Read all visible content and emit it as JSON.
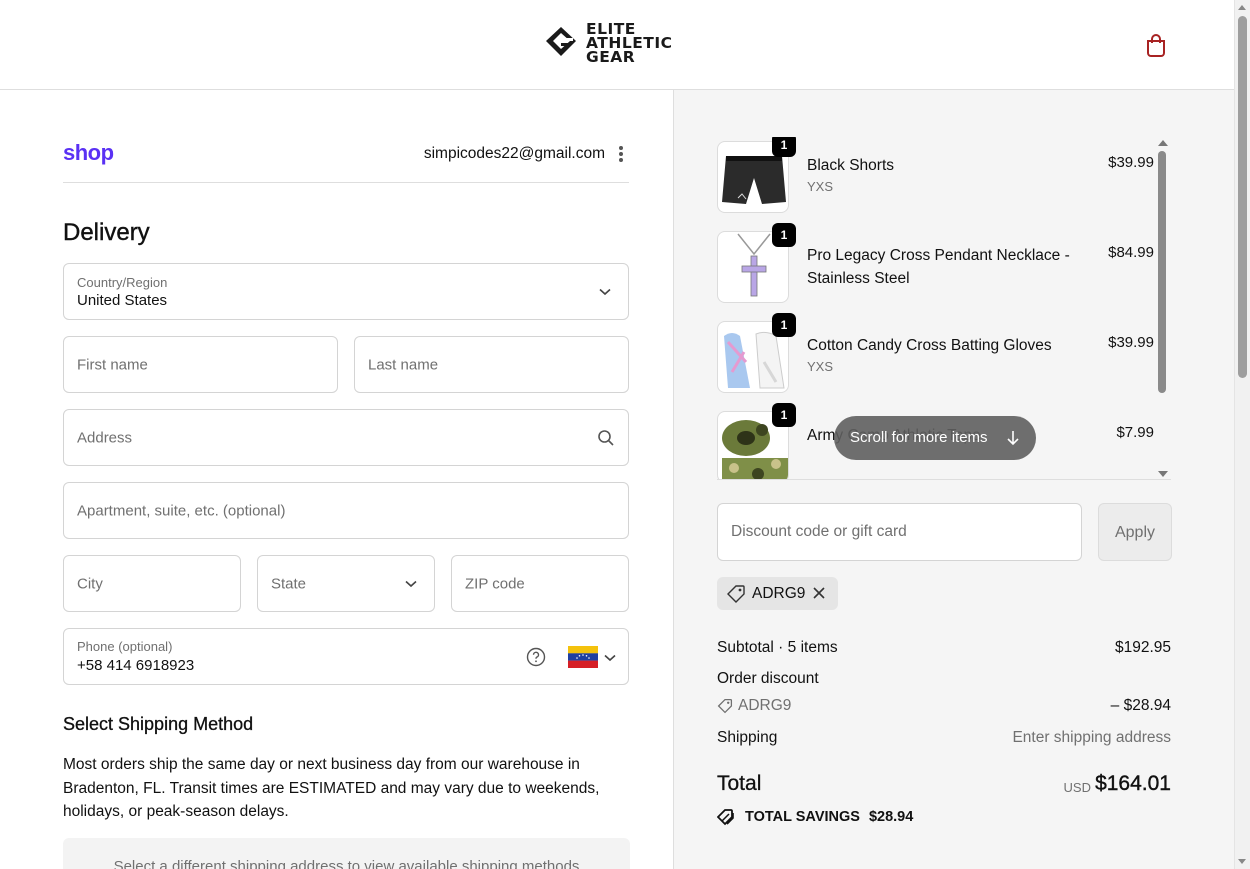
{
  "brand": {
    "logo_lines": [
      "ELITE",
      "ATHLETIC",
      "GEAR"
    ]
  },
  "header": {
    "cart_icon": "shopping-bag-icon"
  },
  "account": {
    "shop_logo": "shop",
    "email": "simpicodes22@gmail.com",
    "menu_icon": "kebab-icon"
  },
  "delivery": {
    "title": "Delivery",
    "country_label": "Country/Region",
    "country_value": "United States",
    "first_name_placeholder": "First name",
    "last_name_placeholder": "Last name",
    "address_placeholder": "Address",
    "apartment_placeholder": "Apartment, suite, etc. (optional)",
    "city_placeholder": "City",
    "state_placeholder": "State",
    "zip_placeholder": "ZIP code",
    "phone_label": "Phone (optional)",
    "phone_value": "+58 414 6918923",
    "phone_flag": "venezuela-flag"
  },
  "shipping": {
    "title": "Select Shipping Method",
    "note": "Most orders ship the same day or next business day from our warehouse in Bradenton, FL. Transit times are ESTIMATED and may vary due to weekends, holidays, or peak-season delays.",
    "placeholder_box": "Select a different shipping address to view available shipping methods"
  },
  "cart": {
    "items": [
      {
        "name": "Black Shorts",
        "variant": "YXS",
        "price": "$39.99",
        "qty": "1"
      },
      {
        "name": "Pro Legacy Cross Pendant Necklace - Stainless Steel",
        "variant": "",
        "price": "$84.99",
        "qty": "1"
      },
      {
        "name": "Cotton Candy Cross Batting Gloves",
        "variant": "YXS",
        "price": "$39.99",
        "qty": "1"
      },
      {
        "name": "Army Camo Athletic Tape",
        "variant": "",
        "price": "$7.99",
        "qty": "1"
      }
    ],
    "scroll_hint": "Scroll for more items"
  },
  "discount": {
    "placeholder": "Discount code or gift card",
    "apply_label": "Apply",
    "applied_code": "ADRG9"
  },
  "summary": {
    "subtotal_label": "Subtotal · 5 items",
    "subtotal_value": "$192.95",
    "order_discount_label": "Order discount",
    "discount_code": "ADRG9",
    "discount_value": "– $28.94",
    "shipping_label": "Shipping",
    "shipping_value": "Enter shipping address",
    "total_label": "Total",
    "currency": "USD",
    "total_value": "$164.01",
    "savings_label": "TOTAL SAVINGS",
    "savings_value": "$28.94"
  },
  "colors": {
    "shop_purple": "#5a31f4",
    "cart_red": "#a82323",
    "panel_bg": "#f5f5f5"
  }
}
